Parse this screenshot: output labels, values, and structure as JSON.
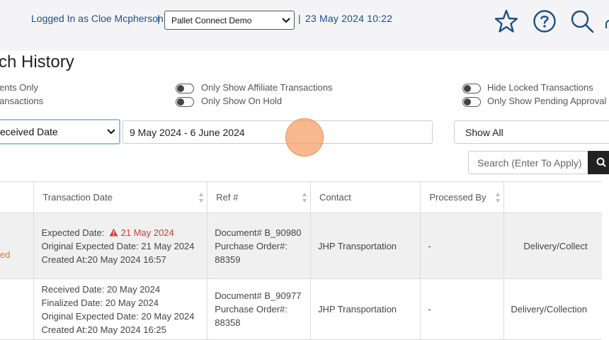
{
  "header": {
    "logged_in": "Logged In as Cloe Mcpherson",
    "sep1": "|",
    "account_select": "Pallet Connect Demo",
    "sep2": "|",
    "datetime": "23 May 2024 10:22"
  },
  "page": {
    "title": "ch History"
  },
  "filters": {
    "left_top": "ents Only",
    "left_bottom": "ansactions",
    "affiliate": "Only Show Affiliate Transactions",
    "on_hold": "Only Show On Hold",
    "hide_locked": "Hide Locked Transactions",
    "pending_approval": "Only Show Pending Approval",
    "date_type": "eceived Date",
    "date_range": "9 May 2024 - 6 June 2024",
    "show_select": "Show All",
    "search_placeholder": "Search (Enter To Apply)"
  },
  "table": {
    "headers": [
      "Transaction Date",
      "Ref #",
      "Contact",
      "Processed By"
    ],
    "rows": [
      {
        "status": "ed",
        "expected_label": "Expected Date:",
        "expected_value": "21 May 2024",
        "original_expected": "Original Expected Date: 21 May 2024",
        "created": "Created At:20 May 2024 16:57",
        "ref_document": "Document# B_90980",
        "ref_po_label": "Purchase Order#:",
        "ref_po": "88359",
        "contact": "JHP Transportation",
        "processed_by": "-",
        "type": "Delivery/Collect"
      },
      {
        "received": "Received Date: 20 May 2024",
        "finalized": "Finalized Date: 20 May 2024",
        "original_expected": "Original Expected Date: 20 May 2024",
        "created": "Created At:20 May 2024 16:25",
        "ref_document": "Document# B_90977",
        "ref_po_label": "Purchase Order#:",
        "ref_po": "88358",
        "contact": "JHP Transportation",
        "processed_by": "-",
        "type": "Delivery/Collection"
      }
    ]
  },
  "colors": {
    "header_blue": "#1d4f8a",
    "warning_red": "#d23c3c",
    "status_orange": "#e07b22"
  }
}
